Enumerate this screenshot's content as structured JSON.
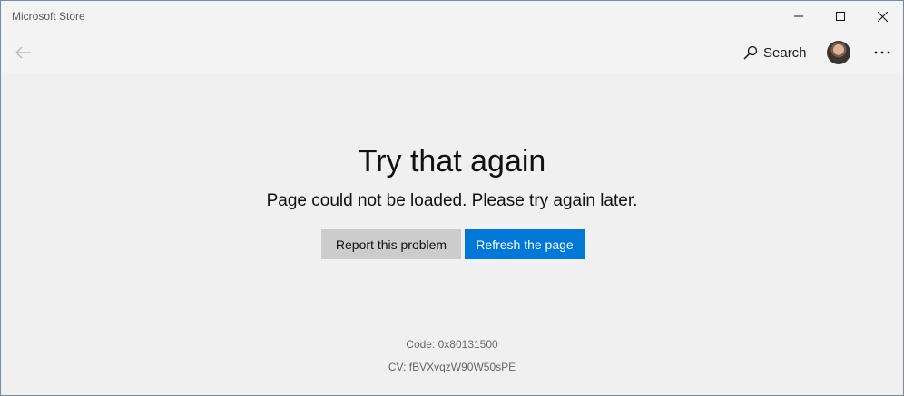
{
  "window": {
    "title": "Microsoft Store"
  },
  "navbar": {
    "search_label": "Search"
  },
  "error": {
    "heading": "Try that again",
    "message": "Page could not be loaded. Please try again later.",
    "report_button": "Report this problem",
    "refresh_button": "Refresh the page",
    "code": "Code: 0x80131500",
    "cv": "CV: fBVXvqzW90W50sPE"
  },
  "colors": {
    "accent": "#0078d7",
    "secondary_button": "#cccccc",
    "background": "#f0f0f0"
  },
  "icons": {
    "back": "back-arrow-icon",
    "search": "search-icon",
    "more": "more-icon",
    "minimize": "minimize-icon",
    "maximize": "maximize-icon",
    "close": "close-icon"
  }
}
